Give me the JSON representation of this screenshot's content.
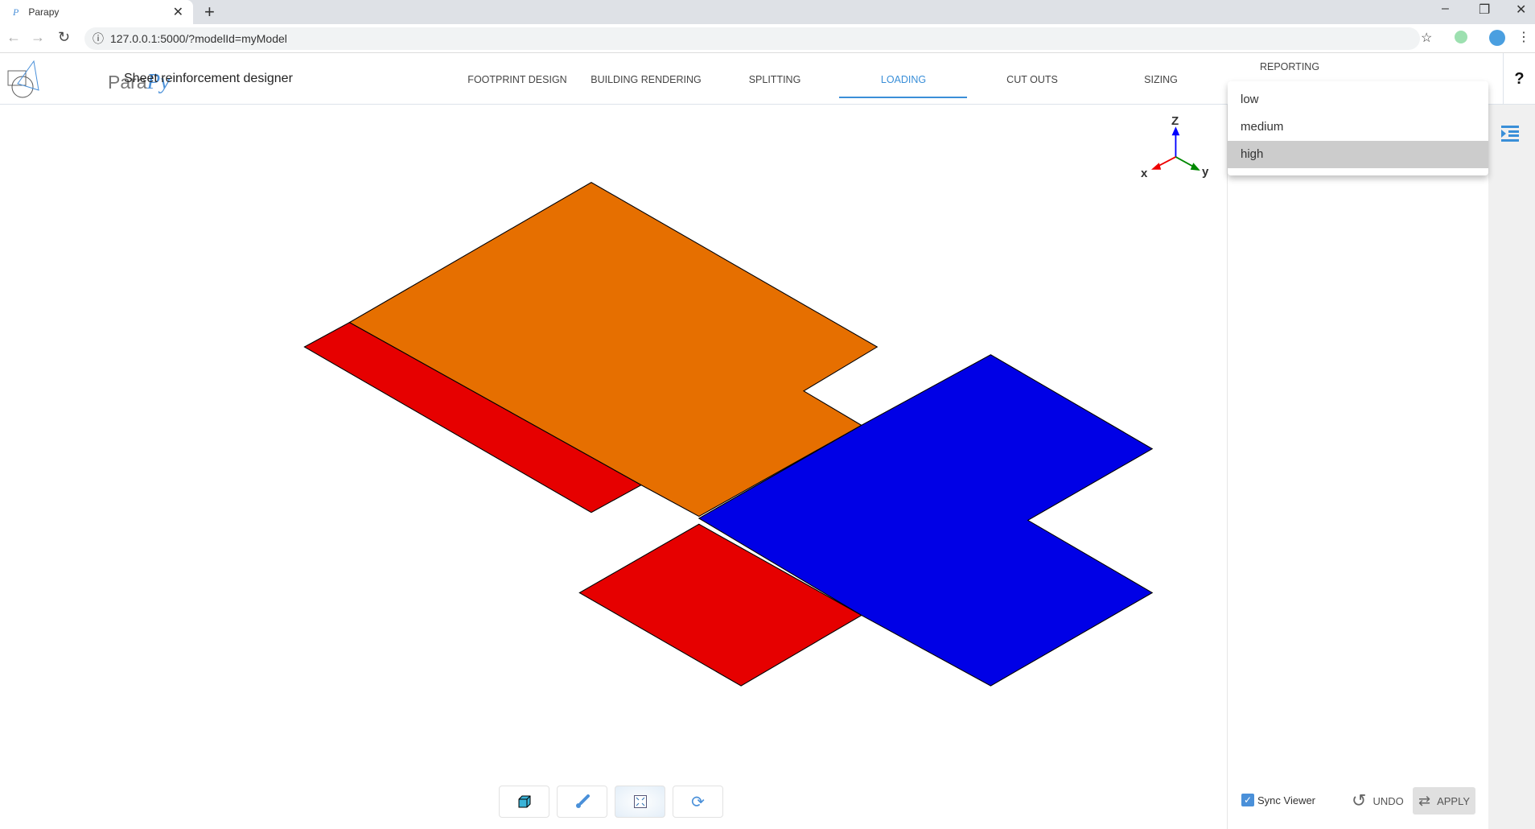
{
  "browser": {
    "tab_title": "Parapy",
    "url": "127.0.0.1:5000/?modelId=myModel"
  },
  "app": {
    "brand_plain": "Para",
    "brand_italic": "Py",
    "subtitle": "Sheet reinforcement designer",
    "help": "?"
  },
  "nav": [
    {
      "label": "FOOTPRINT DESIGN"
    },
    {
      "label": "BUILDING RENDERING"
    },
    {
      "label": "SPLITTING"
    },
    {
      "label": "LOADING"
    },
    {
      "label": "CUT OUTS"
    },
    {
      "label": "SIZING"
    },
    {
      "label": "REPORTING"
    }
  ],
  "active_tab": "LOADING",
  "dropdown": {
    "options": [
      "low",
      "medium",
      "high"
    ],
    "selected": "high"
  },
  "axes": {
    "x": "x",
    "y": "y",
    "z": "Z"
  },
  "viewer_colors": {
    "orange": "#e66f00",
    "red": "#e60000",
    "blue": "#0000e6"
  },
  "bottom": {
    "sync_label": "Sync Viewer",
    "sync_checked": true,
    "undo": "UNDO",
    "apply": "APPLY"
  }
}
